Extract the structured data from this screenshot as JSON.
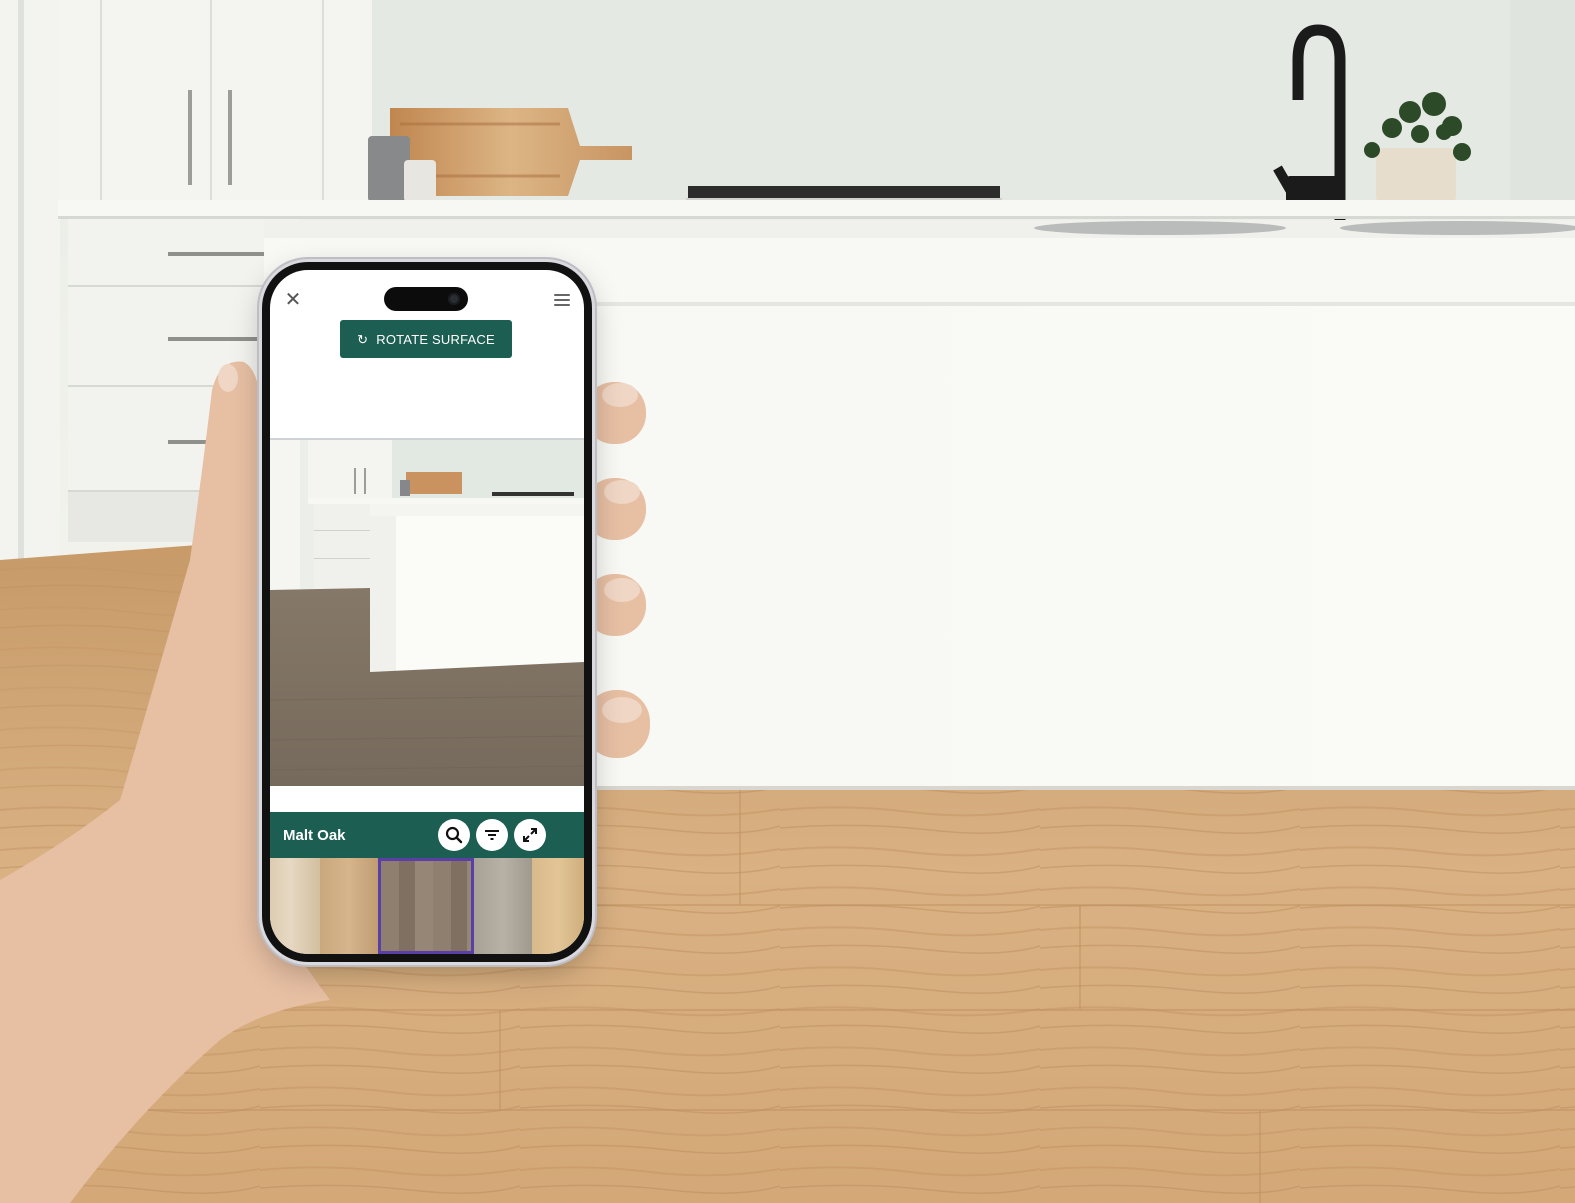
{
  "app": {
    "close_icon": "close-icon",
    "menu_icon": "hamburger-menu-icon",
    "rotate_button": {
      "label": "ROTATE SURFACE",
      "icon": "rotate-icon"
    },
    "selected_product": "Malt Oak",
    "tools": [
      {
        "icon": "search-icon"
      },
      {
        "icon": "filter-icon"
      },
      {
        "icon": "expand-icon"
      }
    ],
    "swatches": [
      {
        "id": "swatch-1",
        "selected": false
      },
      {
        "id": "swatch-2",
        "selected": false
      },
      {
        "id": "swatch-3",
        "selected": true
      },
      {
        "id": "swatch-4",
        "selected": false
      },
      {
        "id": "swatch-5",
        "selected": false
      }
    ]
  },
  "colors": {
    "brand_green": "#1c5e52",
    "selected_outline": "#5a3fa8"
  }
}
